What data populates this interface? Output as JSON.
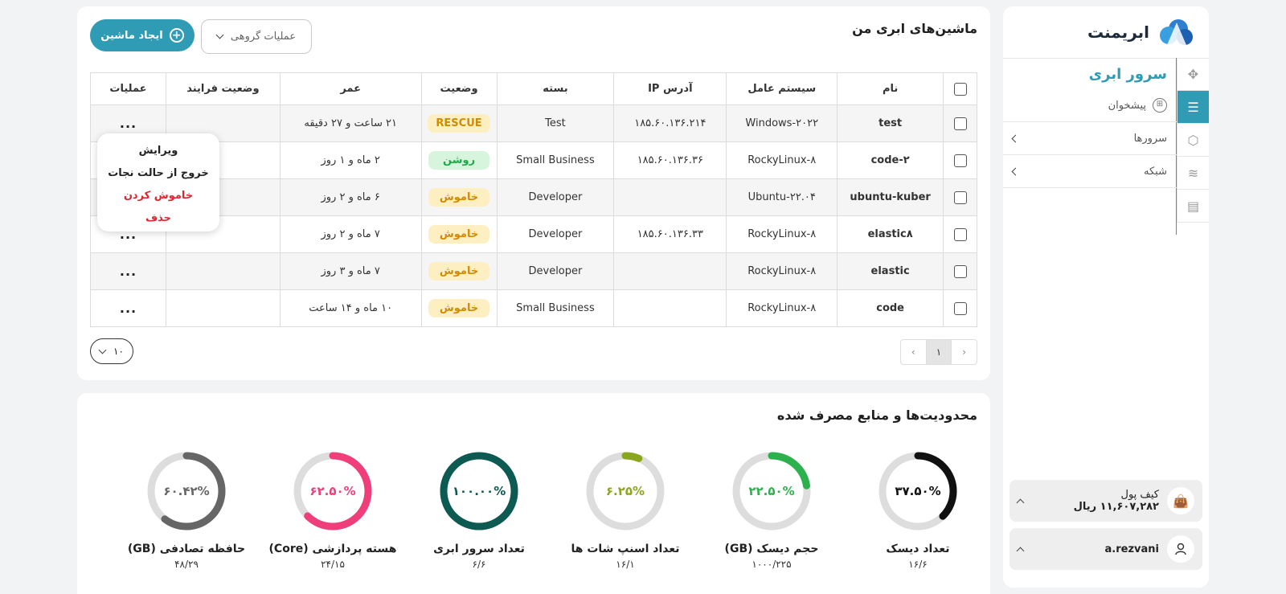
{
  "machines": {
    "title": "ماشین‌های ابری من",
    "create_label": "ایجاد ماشین",
    "group_ops_label": "عملیات گروهی",
    "columns": [
      "نام",
      "سیستم عامل",
      "آدرس IP",
      "بسته",
      "وضعیت",
      "عمر",
      "وضعیت فرایند",
      "عملیات"
    ],
    "rows": [
      {
        "name": "test",
        "os": "Windows-۲۰۲۲",
        "ip": "۱۸۵.۶۰.۱۳۶.۲۱۴",
        "package": "Test",
        "status": "RESCUE",
        "status_kind": "rescue",
        "age": "۲۱ ساعت و ۲۷ دقیقه",
        "process": "",
        "ops": "..."
      },
      {
        "name": "code-۲",
        "os": "RockyLinux-۸",
        "ip": "۱۸۵.۶۰.۱۳۶.۳۶",
        "package": "Small Business",
        "status": "روشن",
        "status_kind": "on",
        "age": "۲ ماه و ۱ روز",
        "process": "",
        "ops": "..."
      },
      {
        "name": "ubuntu-kuber",
        "os": "Ubuntu-۲۲.۰۴",
        "ip": "",
        "package": "Developer",
        "status": "خاموش",
        "status_kind": "off",
        "age": "۶ ماه و ۲ روز",
        "process": "",
        "ops": "..."
      },
      {
        "name": "elastic۸",
        "os": "RockyLinux-۸",
        "ip": "۱۸۵.۶۰.۱۳۶.۳۳",
        "package": "Developer",
        "status": "خاموش",
        "status_kind": "off",
        "age": "۷ ماه و ۲ روز",
        "process": "",
        "ops": "..."
      },
      {
        "name": "elastic",
        "os": "RockyLinux-۸",
        "ip": "",
        "package": "Developer",
        "status": "خاموش",
        "status_kind": "off",
        "age": "۷ ماه و ۳ روز",
        "process": "",
        "ops": "..."
      },
      {
        "name": "code",
        "os": "RockyLinux-۸",
        "ip": "",
        "package": "Small Business",
        "status": "خاموش",
        "status_kind": "off",
        "age": "۱۰ ماه و ۱۴ ساعت",
        "process": "",
        "ops": "..."
      }
    ],
    "context_menu": {
      "edit": "ویرایش",
      "exit_rescue": "خروج از حالت نجات",
      "power_off": "خاموش کردن",
      "delete": "حذف"
    },
    "pagination": {
      "prev": "‹",
      "current": "۱",
      "next": "›"
    },
    "page_size": "۱۰"
  },
  "resources": {
    "title": "محدودیت‌ها و منابع مصرف شده",
    "gauges": [
      {
        "label": "تعداد دیسک",
        "value_text": "۳۷.۵۰%",
        "usage": "۱۶/۶",
        "fraction": 0.375,
        "color": "#111111"
      },
      {
        "label": "حجم دیسک (GB)",
        "value_text": "۲۲.۵۰%",
        "usage": "۱۰۰۰/۲۲۵",
        "fraction": 0.225,
        "color": "#2bb24c"
      },
      {
        "label": "تعداد اسنپ شات ها",
        "value_text": "۶.۲۵%",
        "usage": "۱۶/۱",
        "fraction": 0.0625,
        "color": "#8aa51e"
      },
      {
        "label": "تعداد سرور ابری",
        "value_text": "۱۰۰.۰۰%",
        "usage": "۶/۶",
        "fraction": 1.0,
        "color": "#0d5a52"
      },
      {
        "label": "هسته پردازشی (Core)",
        "value_text": "۶۲.۵۰%",
        "usage": "۲۴/۱۵",
        "fraction": 0.625,
        "color": "#f03e7a"
      },
      {
        "label": "حافظه تصادفی (GB)",
        "value_text": "۶۰.۴۲%",
        "usage": "۴۸/۲۹",
        "fraction": 0.6042,
        "color": "#666666"
      }
    ]
  },
  "sidebar": {
    "brand": "ابریمنت",
    "section_title": "سرور ابری",
    "dashboard_label": "پیشخوان",
    "servers_label": "سرورها",
    "network_label": "شبکه",
    "wallet_label": "کیف پول",
    "wallet_amount": "۱۱,۶۰۷,۲۸۲ ریال",
    "username": "a.rezvani"
  },
  "colors": {
    "accent": "#2f9bb5",
    "track": "#dddddd"
  }
}
